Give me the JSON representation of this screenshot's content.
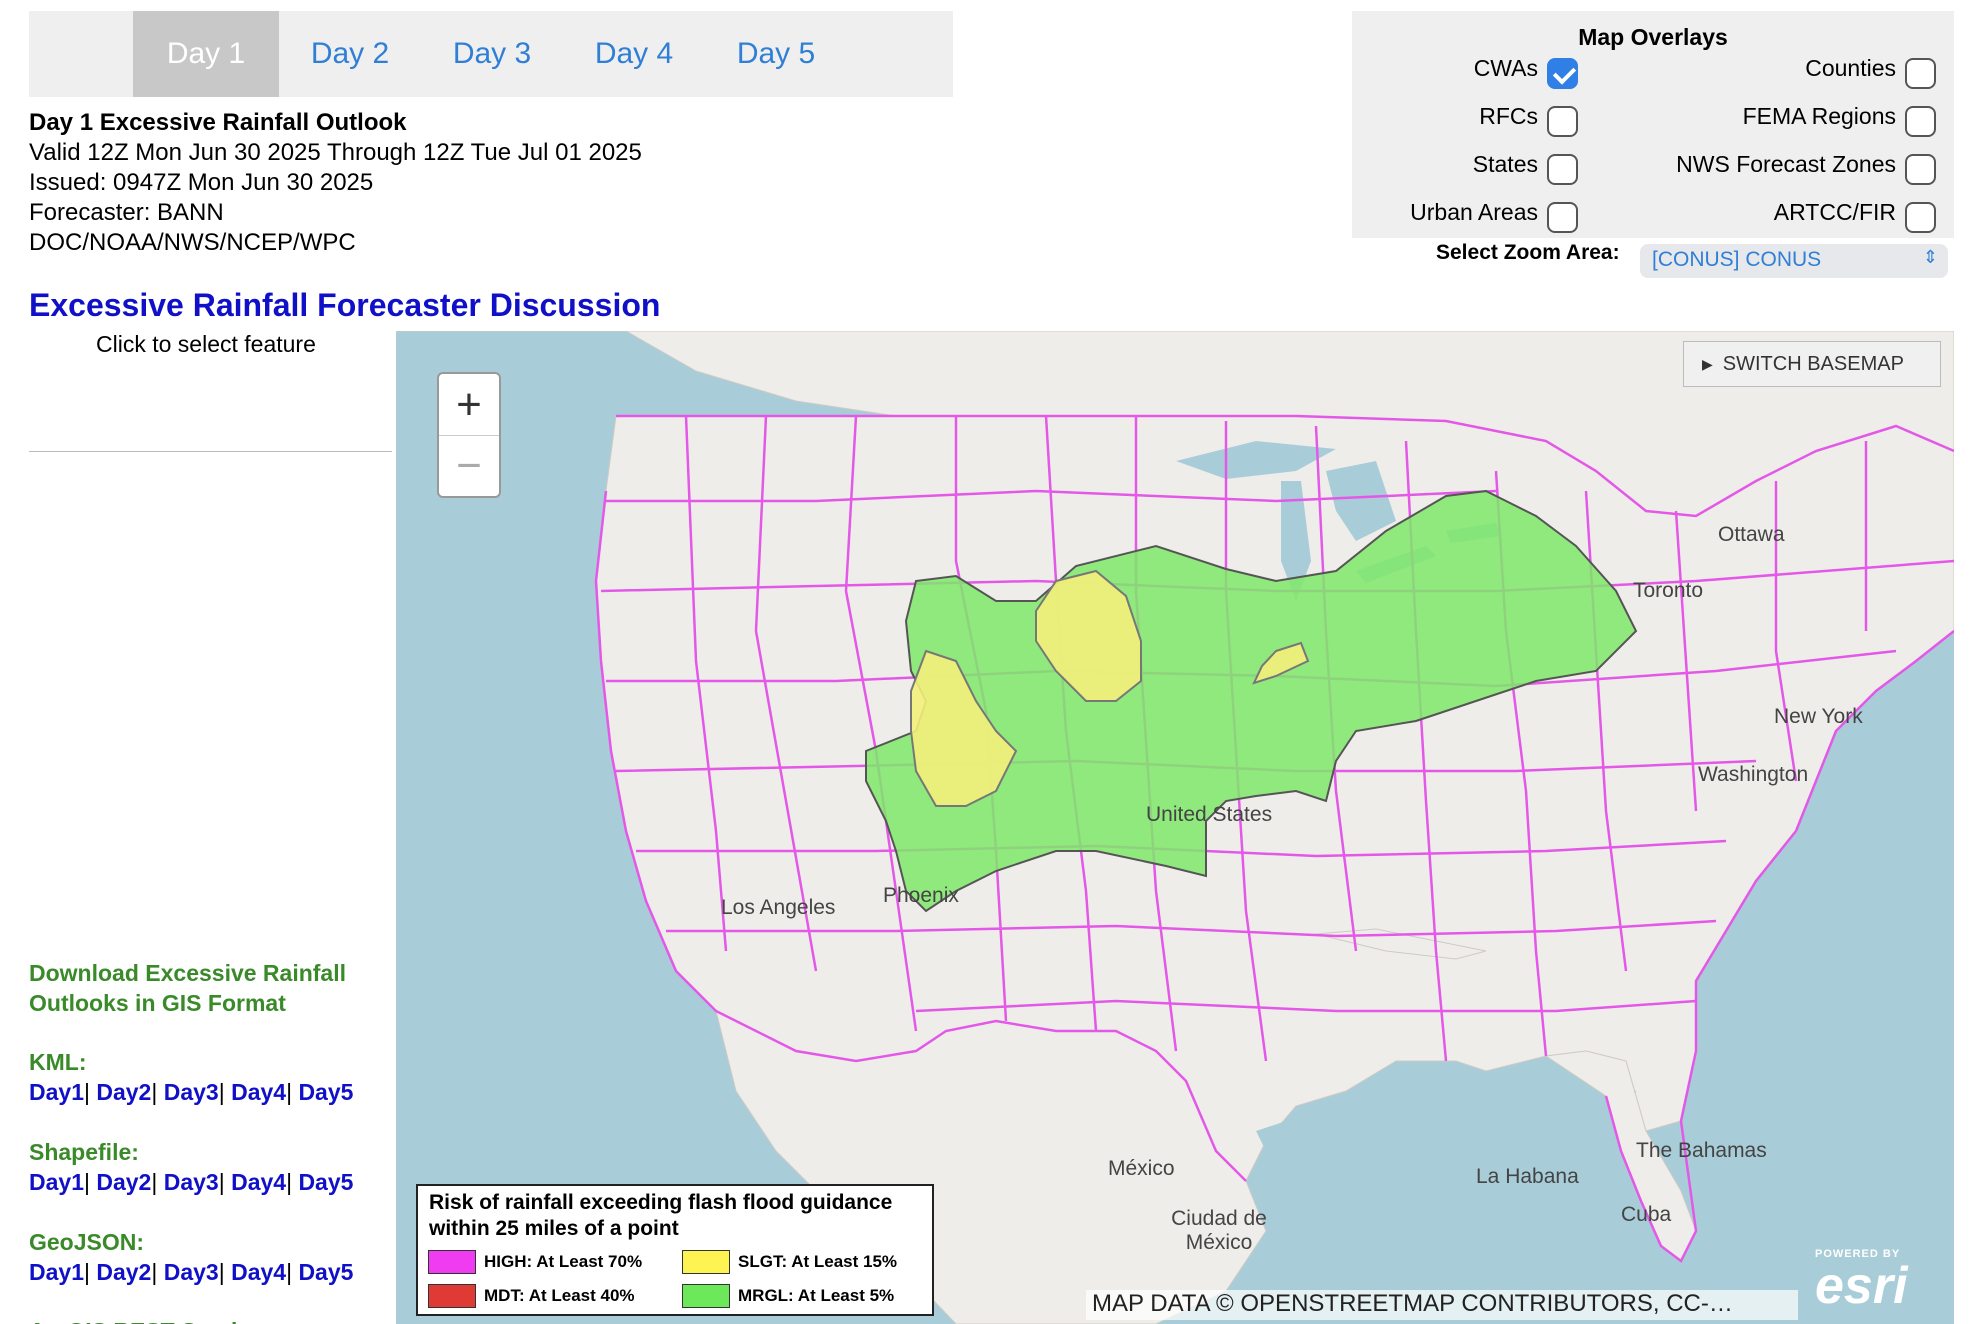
{
  "tabs": [
    {
      "label": "Day 1",
      "active": true
    },
    {
      "label": "Day 2",
      "active": false
    },
    {
      "label": "Day 3",
      "active": false
    },
    {
      "label": "Day 4",
      "active": false
    },
    {
      "label": "Day 5",
      "active": false
    }
  ],
  "outlook": {
    "title": "Day 1 Excessive Rainfall Outlook",
    "valid": "Valid 12Z Mon Jun 30 2025 Through 12Z Tue Jul 01 2025",
    "issued": "Issued: 0947Z Mon Jun 30 2025",
    "forecaster": "Forecaster: BANN",
    "agency": "DOC/NOAA/NWS/NCEP/WPC"
  },
  "discussion_link": "Excessive Rainfall Forecaster Discussion",
  "overlays": {
    "title": "Map Overlays",
    "items": [
      {
        "label": "CWAs",
        "checked": true
      },
      {
        "label": "Counties",
        "checked": false
      },
      {
        "label": "RFCs",
        "checked": false
      },
      {
        "label": "FEMA Regions",
        "checked": false
      },
      {
        "label": "States",
        "checked": false
      },
      {
        "label": "NWS Forecast Zones",
        "checked": false
      },
      {
        "label": "Urban Areas",
        "checked": false
      },
      {
        "label": "ARTCC/FIR",
        "checked": false
      }
    ]
  },
  "zoom_area": {
    "label": "Select Zoom Area:",
    "value": "[CONUS] CONUS"
  },
  "sidebar": {
    "click_prompt": "Click to select feature",
    "download_title_1": "Download Excessive Rainfall",
    "download_title_2": "Outlooks in GIS Format",
    "formats": [
      {
        "label": "KML:",
        "links": [
          "Day1",
          "Day2",
          "Day3",
          "Day4",
          "Day5"
        ]
      },
      {
        "label": "Shapefile:",
        "links": [
          "Day1",
          "Day2",
          "Day3",
          "Day4",
          "Day5"
        ]
      },
      {
        "label": "GeoJSON:",
        "links": [
          "Day1",
          "Day2",
          "Day3",
          "Day4",
          "Day5"
        ]
      }
    ],
    "more_label": "ArcGIS REST Services"
  },
  "map": {
    "zoom_in": "+",
    "zoom_out": "−",
    "basemap_button": "SWITCH BASEMAP",
    "place_labels": [
      "Ottawa",
      "Toronto",
      "New York",
      "Washington",
      "United States",
      "Phoenix",
      "Los Angeles",
      "México",
      "Ciudad de México",
      "La Habana",
      "Cuba",
      "The Bahamas"
    ],
    "attribution": "MAP DATA © OPENSTREETMAP CONTRIBUTORS, CC-…",
    "esri_powered": "POWERED BY",
    "esri_name": "esri"
  },
  "legend": {
    "title_1": "Risk of rainfall exceeding flash flood guidance",
    "title_2": "within 25 miles of a point",
    "items": [
      {
        "label": "HIGH: At Least 70%",
        "color": "#f03cf0"
      },
      {
        "label": "SLGT: At Least 15%",
        "color": "#fdf451"
      },
      {
        "label": "MDT: At Least 40%",
        "color": "#e03a34"
      },
      {
        "label": "MRGL: At Least 5%",
        "color": "#6ce85a"
      }
    ]
  },
  "colors": {
    "tab_text": "#2f7fd6",
    "link_blue": "#1010c8",
    "gis_green": "#3a8a2a",
    "cwa_outline": "#e458e8",
    "mrgl_fill": "#7fe86a",
    "slgt_fill": "#f3ef7a"
  }
}
